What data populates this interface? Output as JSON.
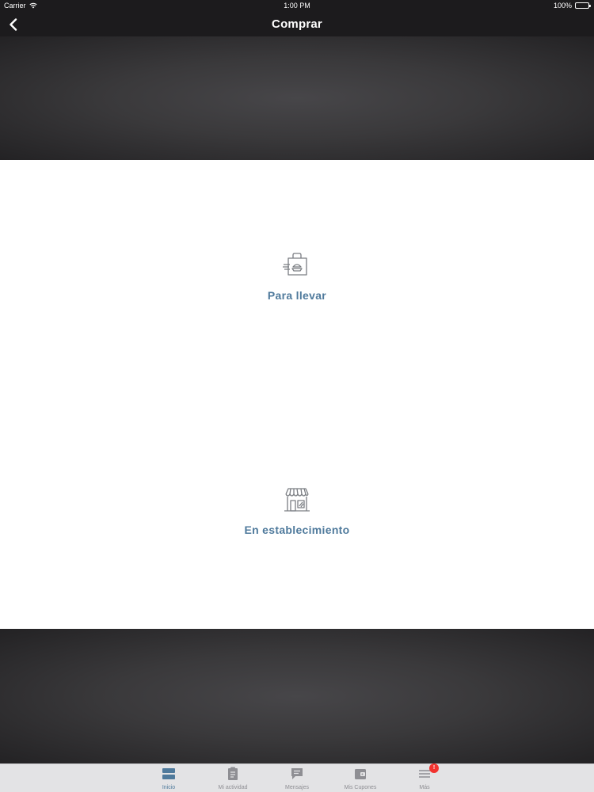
{
  "status_bar": {
    "carrier": "Carrier",
    "time": "1:00 PM",
    "battery": "100%"
  },
  "nav": {
    "title": "Comprar",
    "back_icon": "chevron-left-icon"
  },
  "options": [
    {
      "label": "Para llevar",
      "icon": "takeout-bag-icon"
    },
    {
      "label": "En establecimiento",
      "icon": "storefront-icon"
    }
  ],
  "tabs": [
    {
      "label": "Inicio",
      "icon": "home-icon",
      "active": true
    },
    {
      "label": "Mi actividad",
      "icon": "clipboard-icon",
      "active": false
    },
    {
      "label": "Mensajes",
      "icon": "message-icon",
      "active": false
    },
    {
      "label": "Mis Cupones",
      "icon": "wallet-icon",
      "active": false
    },
    {
      "label": "Más",
      "icon": "menu-icon",
      "active": false,
      "badge": "!"
    }
  ],
  "colors": {
    "accent": "#4f7a9c",
    "bar_background": "#1c1b1d",
    "tab_inactive": "#8e8e93",
    "badge": "#f2332f"
  }
}
